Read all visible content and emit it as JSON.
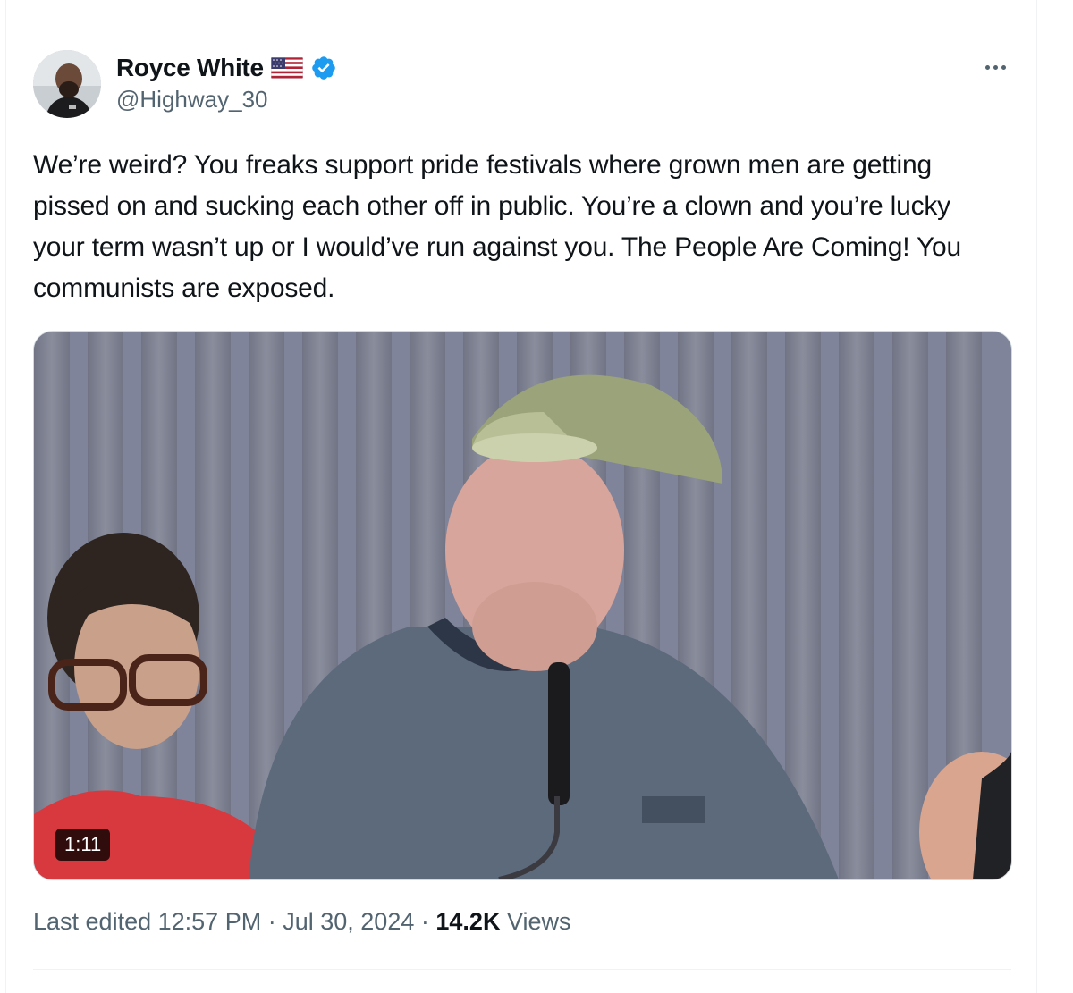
{
  "author": {
    "display_name": "Royce White",
    "handle": "@Highway_30",
    "flag_icon": "us-flag-icon",
    "verified_icon": "verified-badge-icon",
    "verified_color": "#1d9bf0"
  },
  "menu": {
    "icon": "more-horizontal-icon"
  },
  "post": {
    "text": "We’re weird? You freaks support pride festivals where grown men are getting pissed on and sucking each other off in public. You’re a clown and you’re lucky your term wasn’t up or I would’ve run against you. The People Are Coming! You communists are exposed."
  },
  "media": {
    "type": "video",
    "duration": "1:11"
  },
  "meta": {
    "edited_label": "Last edited",
    "time": "12:57 PM",
    "separator": "·",
    "date": "Jul 30, 2024",
    "views_count": "14.2K",
    "views_label": "Views"
  },
  "colors": {
    "text_primary": "#0f1419",
    "text_secondary": "#536471",
    "border": "#eff3f4"
  }
}
